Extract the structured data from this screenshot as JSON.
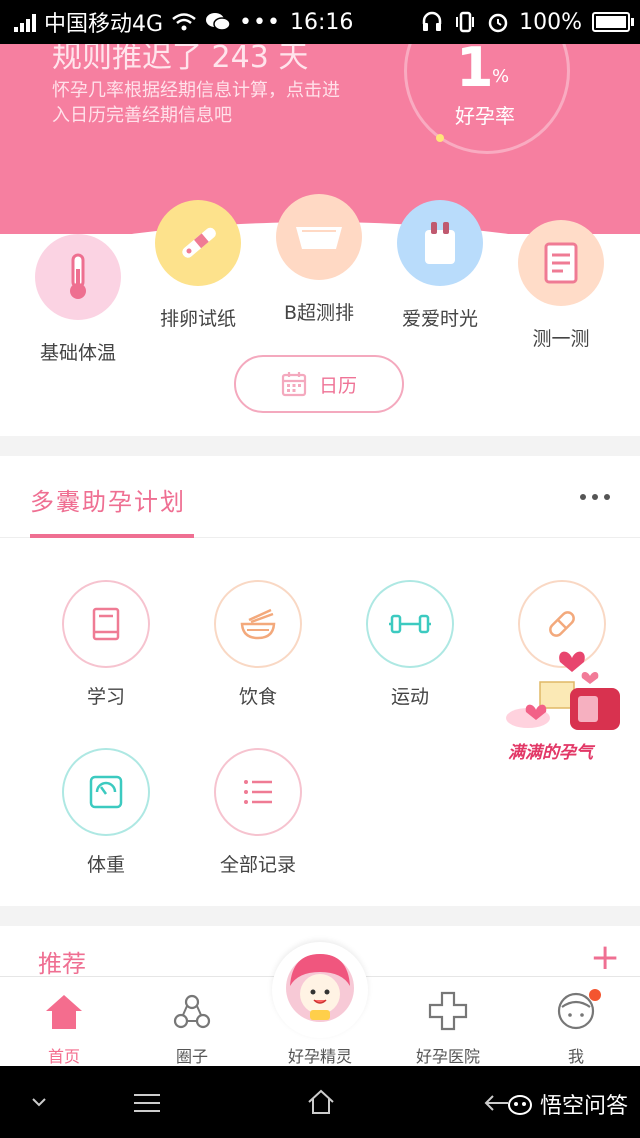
{
  "status_bar": {
    "carrier": "中国移动4G",
    "time": "16:16",
    "battery": "100%",
    "icons": [
      "signal-icon",
      "wifi-icon",
      "wechat-icon",
      "more-icon",
      "headset-icon",
      "vibrate-icon",
      "alarm-icon",
      "battery-icon"
    ]
  },
  "hero": {
    "title": "规则推迟了 243 天",
    "note": "怀孕几率根据经期信息计算，点击进入日历完善经期信息吧",
    "rate_value": "1",
    "rate_unit": "%",
    "rate_label": "好孕率"
  },
  "tools": [
    {
      "label": "基础体温",
      "icon": "thermometer-icon",
      "color": "#fbd3e3"
    },
    {
      "label": "排卵试纸",
      "icon": "ovulation-test-icon",
      "color": "#fde28c"
    },
    {
      "label": "B超测排",
      "icon": "ultrasound-icon",
      "color": "#ffd9c4"
    },
    {
      "label": "爱爱时光",
      "icon": "intimacy-icon",
      "color": "#b9dcfb"
    },
    {
      "label": "测一测",
      "icon": "quiz-icon",
      "color": "#ffdcc8"
    }
  ],
  "calendar_button": "日历",
  "plan": {
    "title": "多囊助孕计划",
    "items": [
      {
        "label": "学习",
        "icon": "book-icon",
        "color": "#ef7b94"
      },
      {
        "label": "饮食",
        "icon": "bowl-icon",
        "color": "#f3a97c"
      },
      {
        "label": "运动",
        "icon": "dumbbell-icon",
        "color": "#3ccac0"
      },
      {
        "label": "",
        "icon": "pill-icon",
        "color": "#f3a97c"
      },
      {
        "label": "体重",
        "icon": "scale-icon",
        "color": "#3ccac0"
      },
      {
        "label": "全部记录",
        "icon": "list-icon",
        "color": "#ef7b94"
      }
    ]
  },
  "sticker_text": "满满的孕气",
  "recommend": {
    "title": "推荐"
  },
  "tabs": [
    {
      "label": "首页",
      "icon": "home-icon",
      "active": true
    },
    {
      "label": "圈子",
      "icon": "circle-group-icon",
      "active": false
    },
    {
      "label": "好孕精灵",
      "icon": "sprite-icon",
      "active": false
    },
    {
      "label": "好孕医院",
      "icon": "hospital-icon",
      "active": false
    },
    {
      "label": "我",
      "icon": "profile-icon",
      "active": false
    }
  ],
  "watermark": "悟空问答",
  "colors": {
    "brand_pink": "#f67fa0",
    "accent": "#ef6f92"
  }
}
